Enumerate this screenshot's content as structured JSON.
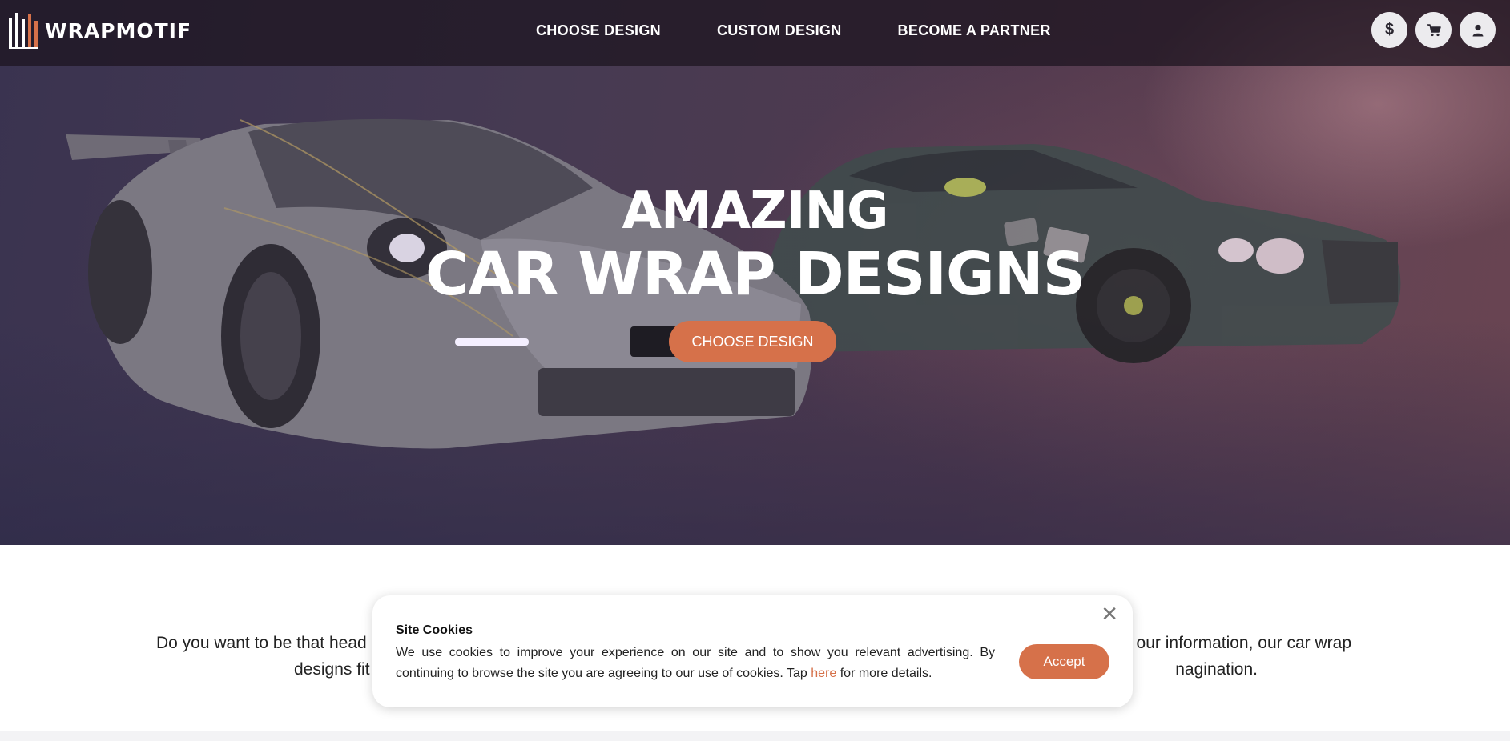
{
  "brand": {
    "name": "WRAPMOTIF",
    "accent": "#d6714a"
  },
  "nav": {
    "links": [
      "CHOOSE DESIGN",
      "CUSTOM DESIGN",
      "BECOME A PARTNER"
    ],
    "icons": [
      "dollar-icon",
      "cart-icon",
      "user-icon"
    ],
    "currency_symbol": "$"
  },
  "hero": {
    "title_line1": "AMAZING",
    "title_line2": "CAR WRAP DESIGNS",
    "cta_label": "CHOOSE DESIGN"
  },
  "intro": {
    "line1_left": "Do you want to be that head",
    "line1_right": "our information, our car wrap",
    "line2_left": "designs fit",
    "line2_right": "nagination."
  },
  "cookie": {
    "title": "Site Cookies",
    "text_before_link": "We use cookies to improve your experience on our site and to show you relevant advertising. By continuing to browse the site you are agreeing to our use of cookies. Tap ",
    "link_label": "here",
    "text_after_link": " for more details.",
    "accept_label": "Accept",
    "close_symbol": "✕"
  }
}
